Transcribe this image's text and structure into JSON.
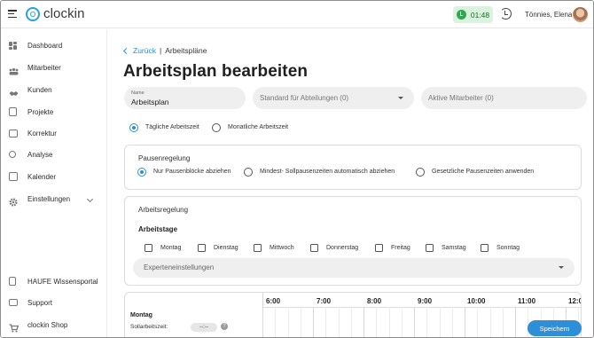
{
  "app": {
    "logo_text": "clockin"
  },
  "topbar": {
    "timer": "01:48",
    "user_name": "Tönnies, Elena",
    "timer_color": "#2fa84f"
  },
  "sidebar": {
    "items": [
      {
        "label": "Dashboard",
        "icon": "dashboard-icon"
      },
      {
        "label": "Mitarbeiter",
        "icon": "employees-icon"
      },
      {
        "label": "Kunden",
        "icon": "customers-icon"
      },
      {
        "label": "Projekte",
        "icon": "projects-icon"
      },
      {
        "label": "Korrektur",
        "icon": "correction-icon"
      },
      {
        "label": "Analyse",
        "icon": "analysis-icon"
      },
      {
        "label": "Kalender",
        "icon": "calendar-icon"
      },
      {
        "label": "Einstellungen",
        "icon": "gear-icon"
      }
    ],
    "bottom": [
      {
        "label": "HAUFE Wissensportal",
        "icon": "book-icon"
      },
      {
        "label": "Support",
        "icon": "support-icon"
      },
      {
        "label": "clockin Shop",
        "icon": "cart-icon"
      }
    ]
  },
  "breadcrumb": {
    "back": "Zurück",
    "current": "Arbeitspläne"
  },
  "page_title": "Arbeitsplan bearbeiten",
  "form": {
    "name_label": "Name",
    "name_value": "Arbeitsplan",
    "standard_placeholder": "Standard für Abteilungen (0)",
    "active_placeholder": "Aktive Mitarbeiter (0)",
    "time_mode": {
      "daily": "Tägliche Arbeitszeit",
      "monthly": "Monatliche Arbeitszeit",
      "selected": "daily"
    }
  },
  "pausenregelung": {
    "title": "Pausenregelung",
    "options": [
      "Nur Pausenblöcke abziehen",
      "Mindest- Sollpausenzeiten automatisch abziehen",
      "Gesetzliche Pausenzeiten anwenden"
    ],
    "selected": 0
  },
  "arbeitsregelung": {
    "title": "Arbeitsregelung",
    "days_title": "Arbeitstage",
    "days": [
      "Montag",
      "Dienstag",
      "Mittwoch",
      "Donnerstag",
      "Freitag",
      "Samstag",
      "Sonntag"
    ],
    "expert_placeholder": "Experteneinstellungen"
  },
  "schedule": {
    "hours": [
      "6:00",
      "7:00",
      "8:00",
      "9:00",
      "10:00",
      "11:00",
      "12:0"
    ],
    "day": "Montag",
    "soll_label": "Sollarbeitszeit:",
    "soll_value": "--:--",
    "info_symbol": "?"
  },
  "save_label": "Speichern",
  "accent_color": "#2d8fcf"
}
